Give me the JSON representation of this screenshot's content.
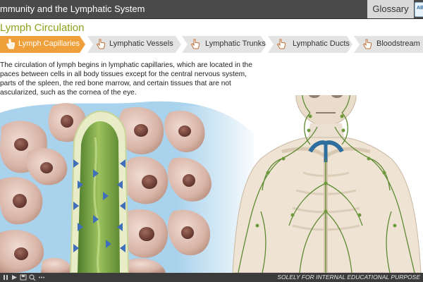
{
  "app": {
    "title": "mmunity and the Lymphatic System"
  },
  "header": {
    "glossary_label": "Glossary",
    "glossary_icon_text": "AB"
  },
  "section": {
    "title": "Lymph Circulation"
  },
  "tabs": [
    {
      "label": "Lymph Capillaries",
      "icon": "hand-pointer-icon",
      "active": true
    },
    {
      "label": "Lymphatic Vessels",
      "icon": "hand-pointer-icon",
      "active": false
    },
    {
      "label": "Lymphatic Trunks",
      "icon": "hand-pointer-icon",
      "active": false
    },
    {
      "label": "Lymphatic Ducts",
      "icon": "hand-pointer-icon",
      "active": false
    },
    {
      "label": "Bloodstream",
      "icon": "hand-pointer-icon",
      "active": false
    }
  ],
  "content": {
    "paragraph_lines": [
      "The circulation of lymph begins in lymphatic capillaries, which are located in the",
      "paces between cells in all body tissues except for the central nervous system,",
      "parts of the spleen, the red bone marrow, and certain tissues that are not",
      "ascularized, such as the cornea of the eye."
    ]
  },
  "footer": {
    "note": "SOLELY FOR INTERNAL EDUCATIONAL PURPOSE",
    "controls": [
      "pause-icon",
      "play-icon",
      "save-icon",
      "zoom-icon",
      "more-icon"
    ]
  },
  "colors": {
    "accent_orange": "#f0a03a",
    "title_green": "#8aa31d",
    "top_bar": "#4a4a4a",
    "tab_gray": "#e3e3e3",
    "lymph_green": "#6f9a3c",
    "tissue_blue": "#a9d2ec"
  }
}
